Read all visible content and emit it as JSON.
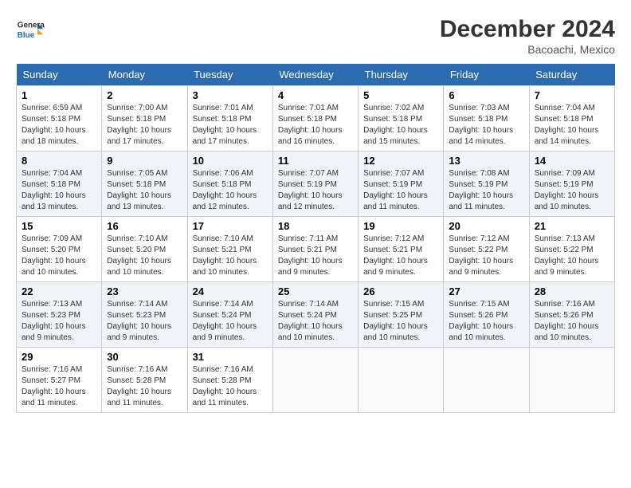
{
  "header": {
    "logo_line1": "General",
    "logo_line2": "Blue",
    "month": "December 2024",
    "location": "Bacoachi, Mexico"
  },
  "weekdays": [
    "Sunday",
    "Monday",
    "Tuesday",
    "Wednesday",
    "Thursday",
    "Friday",
    "Saturday"
  ],
  "weeks": [
    [
      {
        "day": "1",
        "sunrise": "6:59 AM",
        "sunset": "5:18 PM",
        "daylight": "10 hours and 18 minutes."
      },
      {
        "day": "2",
        "sunrise": "7:00 AM",
        "sunset": "5:18 PM",
        "daylight": "10 hours and 17 minutes."
      },
      {
        "day": "3",
        "sunrise": "7:01 AM",
        "sunset": "5:18 PM",
        "daylight": "10 hours and 17 minutes."
      },
      {
        "day": "4",
        "sunrise": "7:01 AM",
        "sunset": "5:18 PM",
        "daylight": "10 hours and 16 minutes."
      },
      {
        "day": "5",
        "sunrise": "7:02 AM",
        "sunset": "5:18 PM",
        "daylight": "10 hours and 15 minutes."
      },
      {
        "day": "6",
        "sunrise": "7:03 AM",
        "sunset": "5:18 PM",
        "daylight": "10 hours and 14 minutes."
      },
      {
        "day": "7",
        "sunrise": "7:04 AM",
        "sunset": "5:18 PM",
        "daylight": "10 hours and 14 minutes."
      }
    ],
    [
      {
        "day": "8",
        "sunrise": "7:04 AM",
        "sunset": "5:18 PM",
        "daylight": "10 hours and 13 minutes."
      },
      {
        "day": "9",
        "sunrise": "7:05 AM",
        "sunset": "5:18 PM",
        "daylight": "10 hours and 13 minutes."
      },
      {
        "day": "10",
        "sunrise": "7:06 AM",
        "sunset": "5:18 PM",
        "daylight": "10 hours and 12 minutes."
      },
      {
        "day": "11",
        "sunrise": "7:07 AM",
        "sunset": "5:19 PM",
        "daylight": "10 hours and 12 minutes."
      },
      {
        "day": "12",
        "sunrise": "7:07 AM",
        "sunset": "5:19 PM",
        "daylight": "10 hours and 11 minutes."
      },
      {
        "day": "13",
        "sunrise": "7:08 AM",
        "sunset": "5:19 PM",
        "daylight": "10 hours and 11 minutes."
      },
      {
        "day": "14",
        "sunrise": "7:09 AM",
        "sunset": "5:19 PM",
        "daylight": "10 hours and 10 minutes."
      }
    ],
    [
      {
        "day": "15",
        "sunrise": "7:09 AM",
        "sunset": "5:20 PM",
        "daylight": "10 hours and 10 minutes."
      },
      {
        "day": "16",
        "sunrise": "7:10 AM",
        "sunset": "5:20 PM",
        "daylight": "10 hours and 10 minutes."
      },
      {
        "day": "17",
        "sunrise": "7:10 AM",
        "sunset": "5:21 PM",
        "daylight": "10 hours and 10 minutes."
      },
      {
        "day": "18",
        "sunrise": "7:11 AM",
        "sunset": "5:21 PM",
        "daylight": "10 hours and 9 minutes."
      },
      {
        "day": "19",
        "sunrise": "7:12 AM",
        "sunset": "5:21 PM",
        "daylight": "10 hours and 9 minutes."
      },
      {
        "day": "20",
        "sunrise": "7:12 AM",
        "sunset": "5:22 PM",
        "daylight": "10 hours and 9 minutes."
      },
      {
        "day": "21",
        "sunrise": "7:13 AM",
        "sunset": "5:22 PM",
        "daylight": "10 hours and 9 minutes."
      }
    ],
    [
      {
        "day": "22",
        "sunrise": "7:13 AM",
        "sunset": "5:23 PM",
        "daylight": "10 hours and 9 minutes."
      },
      {
        "day": "23",
        "sunrise": "7:14 AM",
        "sunset": "5:23 PM",
        "daylight": "10 hours and 9 minutes."
      },
      {
        "day": "24",
        "sunrise": "7:14 AM",
        "sunset": "5:24 PM",
        "daylight": "10 hours and 9 minutes."
      },
      {
        "day": "25",
        "sunrise": "7:14 AM",
        "sunset": "5:24 PM",
        "daylight": "10 hours and 10 minutes."
      },
      {
        "day": "26",
        "sunrise": "7:15 AM",
        "sunset": "5:25 PM",
        "daylight": "10 hours and 10 minutes."
      },
      {
        "day": "27",
        "sunrise": "7:15 AM",
        "sunset": "5:26 PM",
        "daylight": "10 hours and 10 minutes."
      },
      {
        "day": "28",
        "sunrise": "7:16 AM",
        "sunset": "5:26 PM",
        "daylight": "10 hours and 10 minutes."
      }
    ],
    [
      {
        "day": "29",
        "sunrise": "7:16 AM",
        "sunset": "5:27 PM",
        "daylight": "10 hours and 11 minutes."
      },
      {
        "day": "30",
        "sunrise": "7:16 AM",
        "sunset": "5:28 PM",
        "daylight": "10 hours and 11 minutes."
      },
      {
        "day": "31",
        "sunrise": "7:16 AM",
        "sunset": "5:28 PM",
        "daylight": "10 hours and 11 minutes."
      },
      null,
      null,
      null,
      null
    ]
  ]
}
